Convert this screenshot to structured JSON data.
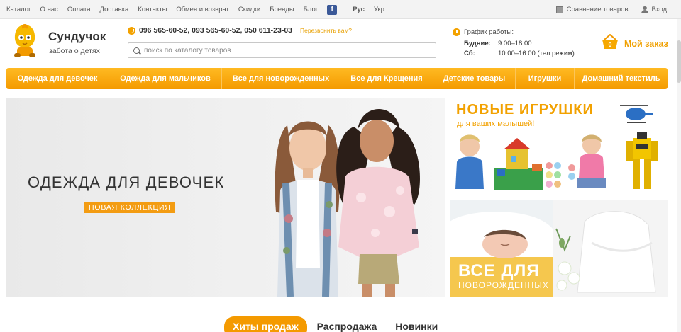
{
  "topbar": {
    "links": [
      "Каталог",
      "О нас",
      "Оплата",
      "Доставка",
      "Контакты",
      "Обмен и возврат",
      "Скидки",
      "Бренды",
      "Блог"
    ],
    "social_icon": "facebook-icon",
    "lang_active": "Рус",
    "lang_other": "Укр",
    "compare_label": "Сравнение товаров",
    "login_label": "Вход"
  },
  "header": {
    "logo_title": "Сундучок",
    "logo_subtitle": "забота о детях",
    "phones": "096 565-60-52,  093 565-60-52,  050 611-23-03",
    "callback_label": "Перезвонить вам?",
    "search_placeholder": "поиск по каталогу товаров",
    "schedule_title": "График работы:",
    "schedule": [
      {
        "day": "Будние:",
        "hours": "9:00–18:00"
      },
      {
        "day": "Сб:",
        "hours": "10:00–16:00 (тел режим)"
      }
    ],
    "cart_count": "0",
    "order_label": "Мой заказ"
  },
  "nav": {
    "items": [
      "Одежда для девочек",
      "Одежда для мальчиков",
      "Все для новорожденных",
      "Все для Крещения",
      "Детские товары",
      "Игрушки",
      "Домашний текстиль"
    ]
  },
  "hero": {
    "title": "ОДЕЖДА ДЛЯ ДЕВОЧЕК",
    "badge": "НОВАЯ КОЛЛЕКЦИЯ"
  },
  "banners": {
    "toys_title": "НОВЫЕ ИГРУШКИ",
    "toys_subtitle": "для ваших малышей!",
    "newborn_title": "ВСЕ ДЛЯ",
    "newborn_subtitle": "НОВОРОЖДЕННЫХ"
  },
  "tabs": [
    "Хиты продаж",
    "Распродажа",
    "Новинки"
  ],
  "colors": {
    "accent": "#f49a00",
    "accent_light": "#ffba22",
    "text": "#333333",
    "facebook": "#3b5998"
  }
}
